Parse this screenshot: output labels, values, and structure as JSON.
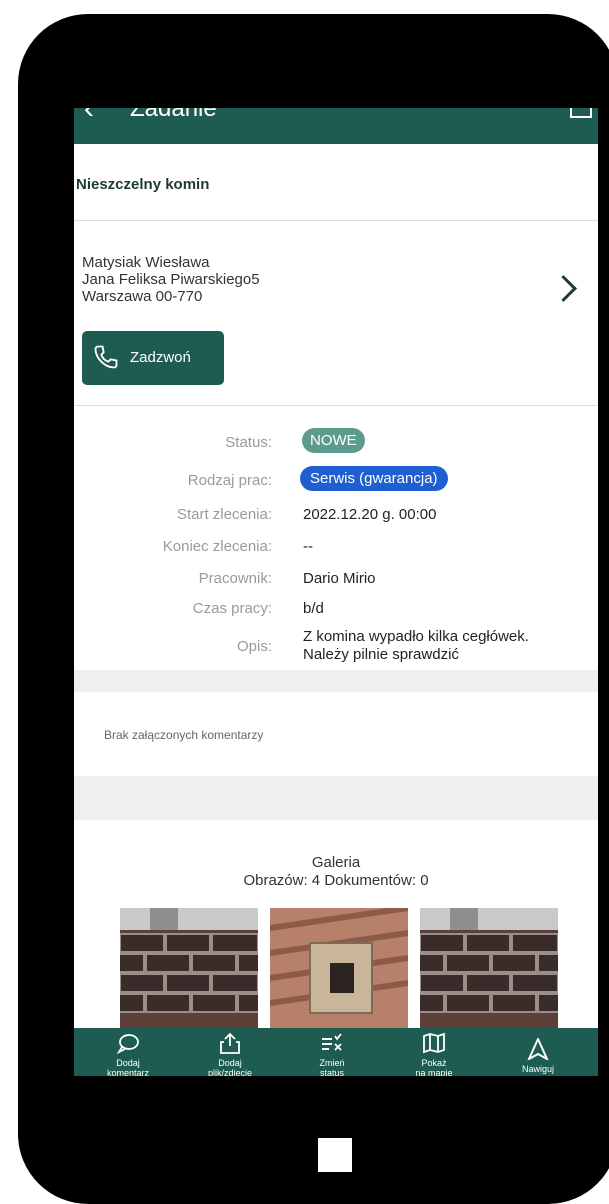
{
  "header": {
    "title": "Zadanie"
  },
  "task_title": "Nieszczelny komin",
  "client": {
    "name": "Matysiak Wiesława",
    "street": "Jana Feliksa Piwarskiego5",
    "city": "Warszawa 00-770",
    "call_label": "Zadzwoń"
  },
  "details": [
    {
      "key": "Status:",
      "value": "NOWE"
    },
    {
      "key": "Rodzaj prac:",
      "value": "Serwis (gwarancja)"
    },
    {
      "key": "Start zlecenia:",
      "value": "2022.12.20 g. 00:00"
    },
    {
      "key": "Koniec zlecenia:",
      "value": "--"
    },
    {
      "key": "Pracownik:",
      "value": "Dario Mirio"
    },
    {
      "key": "Czas pracy:",
      "value": "b/d"
    },
    {
      "key": "Opis:",
      "value_line1": "Z komina wypadło kilka cegłówek.",
      "value_line2": "Należy pilnie sprawdzić"
    }
  ],
  "comments_text": "Brak załączonych komentarzy",
  "gallery": {
    "title": "Galeria",
    "counts": "Obrazów: 4  Dokumentów: 0"
  },
  "bottom_tabs": [
    {
      "line1": "Dodaj",
      "line2": "komentarz",
      "icon": "comment-icon"
    },
    {
      "line1": "Dodaj",
      "line2": "plik/zdjęcie",
      "icon": "upload-icon"
    },
    {
      "line1": "Zmień",
      "line2": "status",
      "icon": "change-status-icon"
    },
    {
      "line1": "Pokaż",
      "line2": "na mapie",
      "icon": "map-icon"
    },
    {
      "line1": "Nawiguj",
      "line2": "",
      "icon": "navigate-icon"
    }
  ],
  "colors": {
    "primary": "#1e5c52",
    "status_badge": "#5d9b8e",
    "type_badge": "#1f5fd1"
  }
}
